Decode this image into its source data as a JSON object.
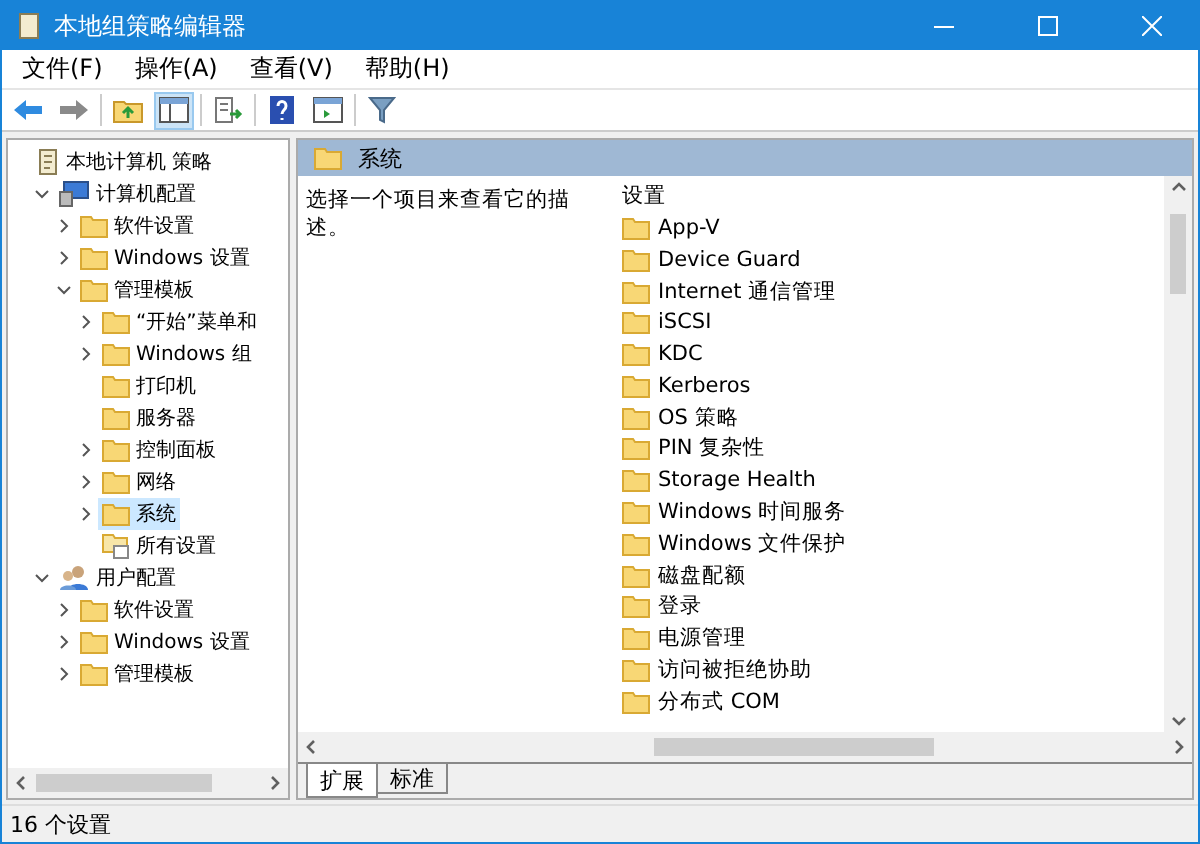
{
  "window": {
    "title": "本地组策略编辑器"
  },
  "menu": [
    "文件(F)",
    "操作(A)",
    "查看(V)",
    "帮助(H)"
  ],
  "tree": [
    {
      "label": "本地计算机 策略",
      "kind": "policy",
      "selected": false,
      "children": [
        {
          "label": "计算机配置",
          "kind": "computer",
          "expanded": true,
          "selected": false,
          "children": [
            {
              "label": "软件设置",
              "kind": "folder",
              "expanded": false,
              "selected": false
            },
            {
              "label": "Windows 设置",
              "kind": "folder",
              "expanded": false,
              "selected": false
            },
            {
              "label": "管理模板",
              "kind": "folder",
              "expanded": true,
              "selected": false,
              "children": [
                {
                  "label": "“开始”菜单和",
                  "kind": "folder",
                  "expanded": false,
                  "selected": false
                },
                {
                  "label": "Windows 组",
                  "kind": "folder",
                  "expanded": false,
                  "selected": false
                },
                {
                  "label": "打印机",
                  "kind": "folder",
                  "selected": false
                },
                {
                  "label": "服务器",
                  "kind": "folder",
                  "selected": false
                },
                {
                  "label": "控制面板",
                  "kind": "folder",
                  "expanded": false,
                  "selected": false
                },
                {
                  "label": "网络",
                  "kind": "folder",
                  "expanded": false,
                  "selected": false
                },
                {
                  "label": "系统",
                  "kind": "folder",
                  "expanded": false,
                  "selected": true
                },
                {
                  "label": "所有设置",
                  "kind": "settings",
                  "selected": false
                }
              ]
            }
          ]
        },
        {
          "label": "用户配置",
          "kind": "user",
          "expanded": true,
          "selected": false,
          "children": [
            {
              "label": "软件设置",
              "kind": "folder",
              "expanded": false,
              "selected": false
            },
            {
              "label": "Windows 设置",
              "kind": "folder",
              "expanded": false,
              "selected": false
            },
            {
              "label": "管理模板",
              "kind": "folder",
              "expanded": false,
              "selected": false
            }
          ]
        }
      ]
    }
  ],
  "details": {
    "header": "系统",
    "description": "选择一个项目来查看它的描述。",
    "column": "设置",
    "items": [
      "App-V",
      "Device Guard",
      "Internet 通信管理",
      "iSCSI",
      "KDC",
      "Kerberos",
      "OS 策略",
      "PIN 复杂性",
      "Storage Health",
      "Windows 时间服务",
      "Windows 文件保护",
      "磁盘配额",
      "登录",
      "电源管理",
      "访问被拒绝协助",
      "分布式 COM"
    ]
  },
  "tabs": [
    {
      "label": "扩展",
      "selected": true
    },
    {
      "label": "标准",
      "selected": false
    }
  ],
  "status_bar": "16 个设置"
}
